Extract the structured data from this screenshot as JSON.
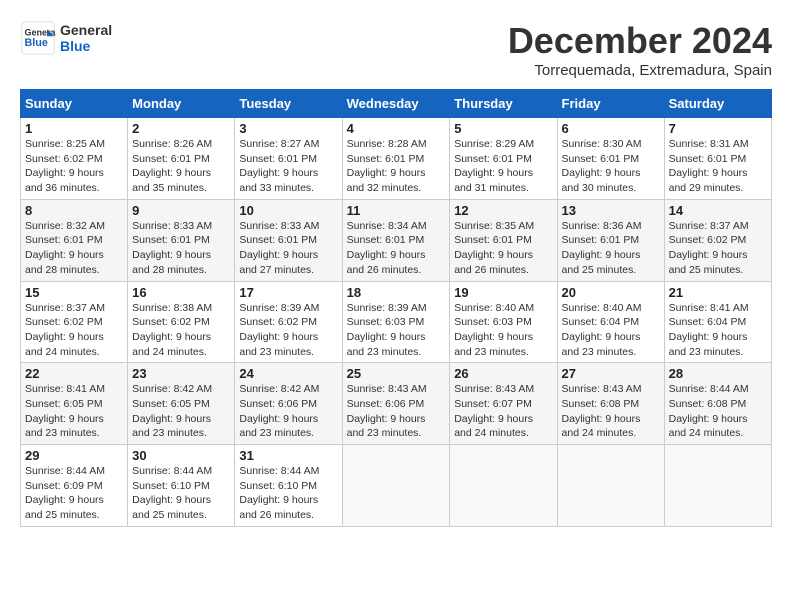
{
  "header": {
    "logo_line1": "General",
    "logo_line2": "Blue",
    "main_title": "December 2024",
    "subtitle": "Torrequemada, Extremadura, Spain"
  },
  "calendar": {
    "days_of_week": [
      "Sunday",
      "Monday",
      "Tuesday",
      "Wednesday",
      "Thursday",
      "Friday",
      "Saturday"
    ],
    "weeks": [
      [
        {
          "day": "",
          "info": ""
        },
        {
          "day": "2",
          "info": "Sunrise: 8:26 AM\nSunset: 6:01 PM\nDaylight: 9 hours\nand 35 minutes."
        },
        {
          "day": "3",
          "info": "Sunrise: 8:27 AM\nSunset: 6:01 PM\nDaylight: 9 hours\nand 33 minutes."
        },
        {
          "day": "4",
          "info": "Sunrise: 8:28 AM\nSunset: 6:01 PM\nDaylight: 9 hours\nand 32 minutes."
        },
        {
          "day": "5",
          "info": "Sunrise: 8:29 AM\nSunset: 6:01 PM\nDaylight: 9 hours\nand 31 minutes."
        },
        {
          "day": "6",
          "info": "Sunrise: 8:30 AM\nSunset: 6:01 PM\nDaylight: 9 hours\nand 30 minutes."
        },
        {
          "day": "7",
          "info": "Sunrise: 8:31 AM\nSunset: 6:01 PM\nDaylight: 9 hours\nand 29 minutes."
        }
      ],
      [
        {
          "day": "1",
          "info": "Sunrise: 8:25 AM\nSunset: 6:02 PM\nDaylight: 9 hours\nand 36 minutes."
        },
        {
          "day": "",
          "info": ""
        },
        {
          "day": "",
          "info": ""
        },
        {
          "day": "",
          "info": ""
        },
        {
          "day": "",
          "info": ""
        },
        {
          "day": "",
          "info": ""
        },
        {
          "day": "",
          "info": ""
        }
      ],
      [
        {
          "day": "8",
          "info": "Sunrise: 8:32 AM\nSunset: 6:01 PM\nDaylight: 9 hours\nand 28 minutes."
        },
        {
          "day": "9",
          "info": "Sunrise: 8:33 AM\nSunset: 6:01 PM\nDaylight: 9 hours\nand 28 minutes."
        },
        {
          "day": "10",
          "info": "Sunrise: 8:33 AM\nSunset: 6:01 PM\nDaylight: 9 hours\nand 27 minutes."
        },
        {
          "day": "11",
          "info": "Sunrise: 8:34 AM\nSunset: 6:01 PM\nDaylight: 9 hours\nand 26 minutes."
        },
        {
          "day": "12",
          "info": "Sunrise: 8:35 AM\nSunset: 6:01 PM\nDaylight: 9 hours\nand 26 minutes."
        },
        {
          "day": "13",
          "info": "Sunrise: 8:36 AM\nSunset: 6:01 PM\nDaylight: 9 hours\nand 25 minutes."
        },
        {
          "day": "14",
          "info": "Sunrise: 8:37 AM\nSunset: 6:02 PM\nDaylight: 9 hours\nand 25 minutes."
        }
      ],
      [
        {
          "day": "15",
          "info": "Sunrise: 8:37 AM\nSunset: 6:02 PM\nDaylight: 9 hours\nand 24 minutes."
        },
        {
          "day": "16",
          "info": "Sunrise: 8:38 AM\nSunset: 6:02 PM\nDaylight: 9 hours\nand 24 minutes."
        },
        {
          "day": "17",
          "info": "Sunrise: 8:39 AM\nSunset: 6:02 PM\nDaylight: 9 hours\nand 23 minutes."
        },
        {
          "day": "18",
          "info": "Sunrise: 8:39 AM\nSunset: 6:03 PM\nDaylight: 9 hours\nand 23 minutes."
        },
        {
          "day": "19",
          "info": "Sunrise: 8:40 AM\nSunset: 6:03 PM\nDaylight: 9 hours\nand 23 minutes."
        },
        {
          "day": "20",
          "info": "Sunrise: 8:40 AM\nSunset: 6:04 PM\nDaylight: 9 hours\nand 23 minutes."
        },
        {
          "day": "21",
          "info": "Sunrise: 8:41 AM\nSunset: 6:04 PM\nDaylight: 9 hours\nand 23 minutes."
        }
      ],
      [
        {
          "day": "22",
          "info": "Sunrise: 8:41 AM\nSunset: 6:05 PM\nDaylight: 9 hours\nand 23 minutes."
        },
        {
          "day": "23",
          "info": "Sunrise: 8:42 AM\nSunset: 6:05 PM\nDaylight: 9 hours\nand 23 minutes."
        },
        {
          "day": "24",
          "info": "Sunrise: 8:42 AM\nSunset: 6:06 PM\nDaylight: 9 hours\nand 23 minutes."
        },
        {
          "day": "25",
          "info": "Sunrise: 8:43 AM\nSunset: 6:06 PM\nDaylight: 9 hours\nand 23 minutes."
        },
        {
          "day": "26",
          "info": "Sunrise: 8:43 AM\nSunset: 6:07 PM\nDaylight: 9 hours\nand 24 minutes."
        },
        {
          "day": "27",
          "info": "Sunrise: 8:43 AM\nSunset: 6:08 PM\nDaylight: 9 hours\nand 24 minutes."
        },
        {
          "day": "28",
          "info": "Sunrise: 8:44 AM\nSunset: 6:08 PM\nDaylight: 9 hours\nand 24 minutes."
        }
      ],
      [
        {
          "day": "29",
          "info": "Sunrise: 8:44 AM\nSunset: 6:09 PM\nDaylight: 9 hours\nand 25 minutes."
        },
        {
          "day": "30",
          "info": "Sunrise: 8:44 AM\nSunset: 6:10 PM\nDaylight: 9 hours\nand 25 minutes."
        },
        {
          "day": "31",
          "info": "Sunrise: 8:44 AM\nSunset: 6:10 PM\nDaylight: 9 hours\nand 26 minutes."
        },
        {
          "day": "",
          "info": ""
        },
        {
          "day": "",
          "info": ""
        },
        {
          "day": "",
          "info": ""
        },
        {
          "day": "",
          "info": ""
        }
      ]
    ]
  }
}
